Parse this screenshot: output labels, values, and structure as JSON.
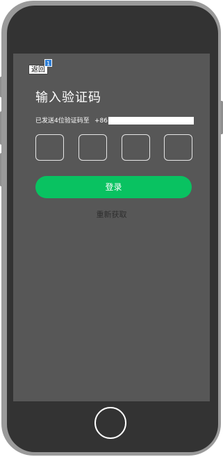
{
  "header": {
    "back_label": "返回",
    "back_badge": "1"
  },
  "main": {
    "title": "输入验证码",
    "sent_prefix": "已发送4位验证码至",
    "country_code": "+86",
    "code_digits": [
      "",
      "",
      "",
      ""
    ],
    "login_label": "登录",
    "refetch_label": "重新获取"
  },
  "colors": {
    "screen_bg": "#575757",
    "phone_frame": "#9a9a9a",
    "phone_body": "#333333",
    "accent_green": "#09c261",
    "badge_blue": "#2f7fd6"
  }
}
